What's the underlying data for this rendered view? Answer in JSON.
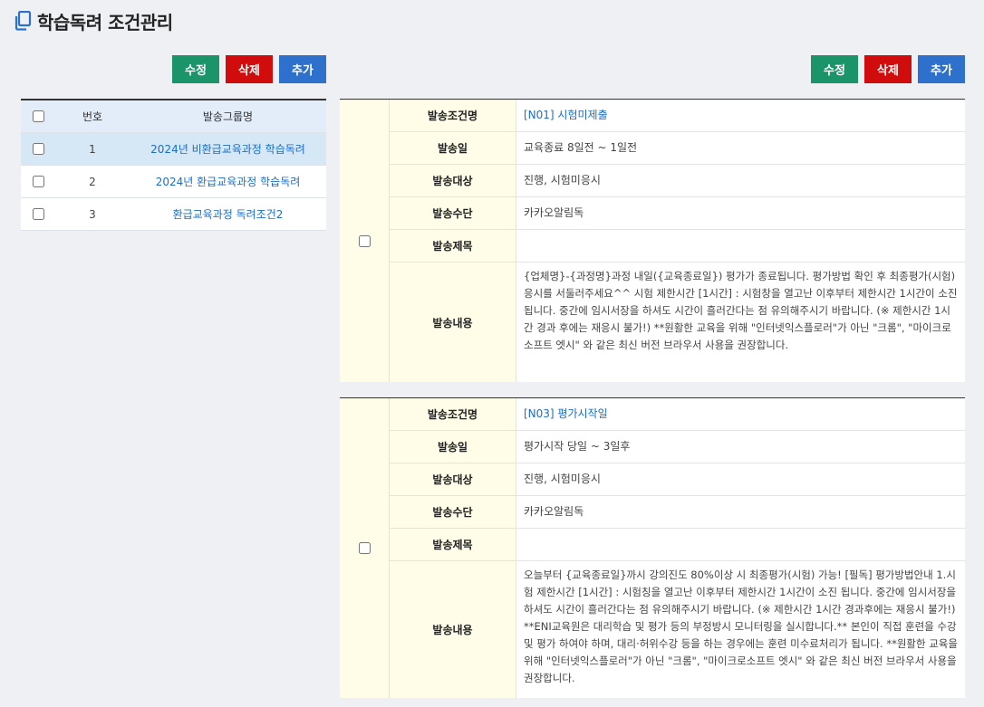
{
  "page": {
    "title": "학습독려 조건관리",
    "title_icon": "copy-icon"
  },
  "buttons": {
    "edit": "수정",
    "delete": "삭제",
    "add": "추가"
  },
  "colors": {
    "edit": "#1c9469",
    "delete": "#d00c0c",
    "add": "#2d71cd",
    "link": "#1a6fc4",
    "label_bg": "#fffde7"
  },
  "group_list": {
    "headers": {
      "no": "번호",
      "name": "발송그룹명"
    },
    "rows": [
      {
        "no": "1",
        "name": "2024년 비환급교육과정 학습독려",
        "selected": true
      },
      {
        "no": "2",
        "name": "2024년 환급교육과정 학습독려",
        "selected": false
      },
      {
        "no": "3",
        "name": "환급교육과정 독려조건2",
        "selected": false
      }
    ]
  },
  "labels": {
    "cond_name": "발송조건명",
    "send_day": "발송일",
    "target": "발송대상",
    "method": "발송수단",
    "subject": "발송제목",
    "content": "발송내용"
  },
  "conditions": [
    {
      "cond_name": "[N01] 시험미제출",
      "send_day": "교육종료 8일전 ~ 1일전",
      "target": "진행, 시험미응시",
      "method": "카카오알림독",
      "subject": "",
      "content": "{업체명}-{과정명}과정 내일({교육종료일}) 평가가 종료됩니다. 평가방법 확인 후 최종평가(시험)응시를 서둘러주세요^^ 시험 제한시간 [1시간] : 시험창을 열고난 이후부터 제한시간 1시간이 소진 됩니다. 중간에 임시서장을 하셔도 시간이 흘러간다는 점 유의해주시기 바랍니다. (※ 제한시간 1시간 경과 후에는 재응시 불가!) **원활한 교육을 위해 \"인터넷익스플로러\"가 아닌 \"크롬\", \"마이크로소프트 엣시\" 와 같은 최신 버전 브라우서 사용을 권장합니다."
    },
    {
      "cond_name": "[N03] 평가시작일",
      "send_day": "평가시작 당일 ~ 3일후",
      "target": "진행, 시험미응시",
      "method": "카카오알림독",
      "subject": "",
      "content": "오늘부터 {교육종료일}까시 강의진도 80%이상 시 최종평가(시험) 가능! [필독] 평가방법안내 1.시험 제한시간 [1시간] : 시험칭을 열고난 이후부터 제한시간 1시간이 소진 됩니다. 중간에 임시서장을 하셔도 시간이 흘러간다는 점 유의해주시기 바랍니다. (※ 제한시간 1시간 경과후에는 재응시 불가!) **ENI교육원은 대리학습 및 평가 등의 부정방시 모니터링을 실시합니다.** 본인이 직접 훈련을 수강 및 평가 하여야 하며, 대리·허위수강 등을 하는 경우에는 훈련 미수료처리가 됩니다. **원활한 교육을 위해 \"인터넷익스플로러\"가 아닌 \"크롬\", \"마이크로소프트 엣시\" 와 같은 최신 버전 브라우서 사용을 권장합니다."
    }
  ]
}
